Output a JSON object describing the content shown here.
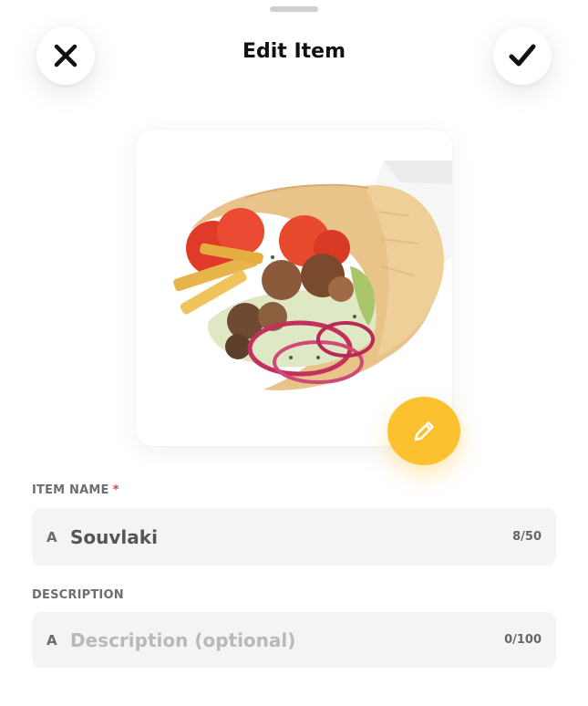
{
  "header": {
    "title": "Edit Item",
    "close_icon": "close-icon",
    "confirm_icon": "check-icon"
  },
  "image": {
    "alt": "Souvlaki",
    "edit_icon": "pencil-icon"
  },
  "fields": {
    "item_name": {
      "label": "ITEM NAME",
      "required_mark": "*",
      "type_icon": "A",
      "value": "Souvlaki",
      "counter": "8/50"
    },
    "description": {
      "label": "DESCRIPTION",
      "type_icon": "A",
      "value": "",
      "placeholder": "Description (optional)",
      "counter": "0/100"
    }
  },
  "colors": {
    "accent": "#fcc12f",
    "required": "#e0413a",
    "field_bg": "#f4f4f4"
  }
}
